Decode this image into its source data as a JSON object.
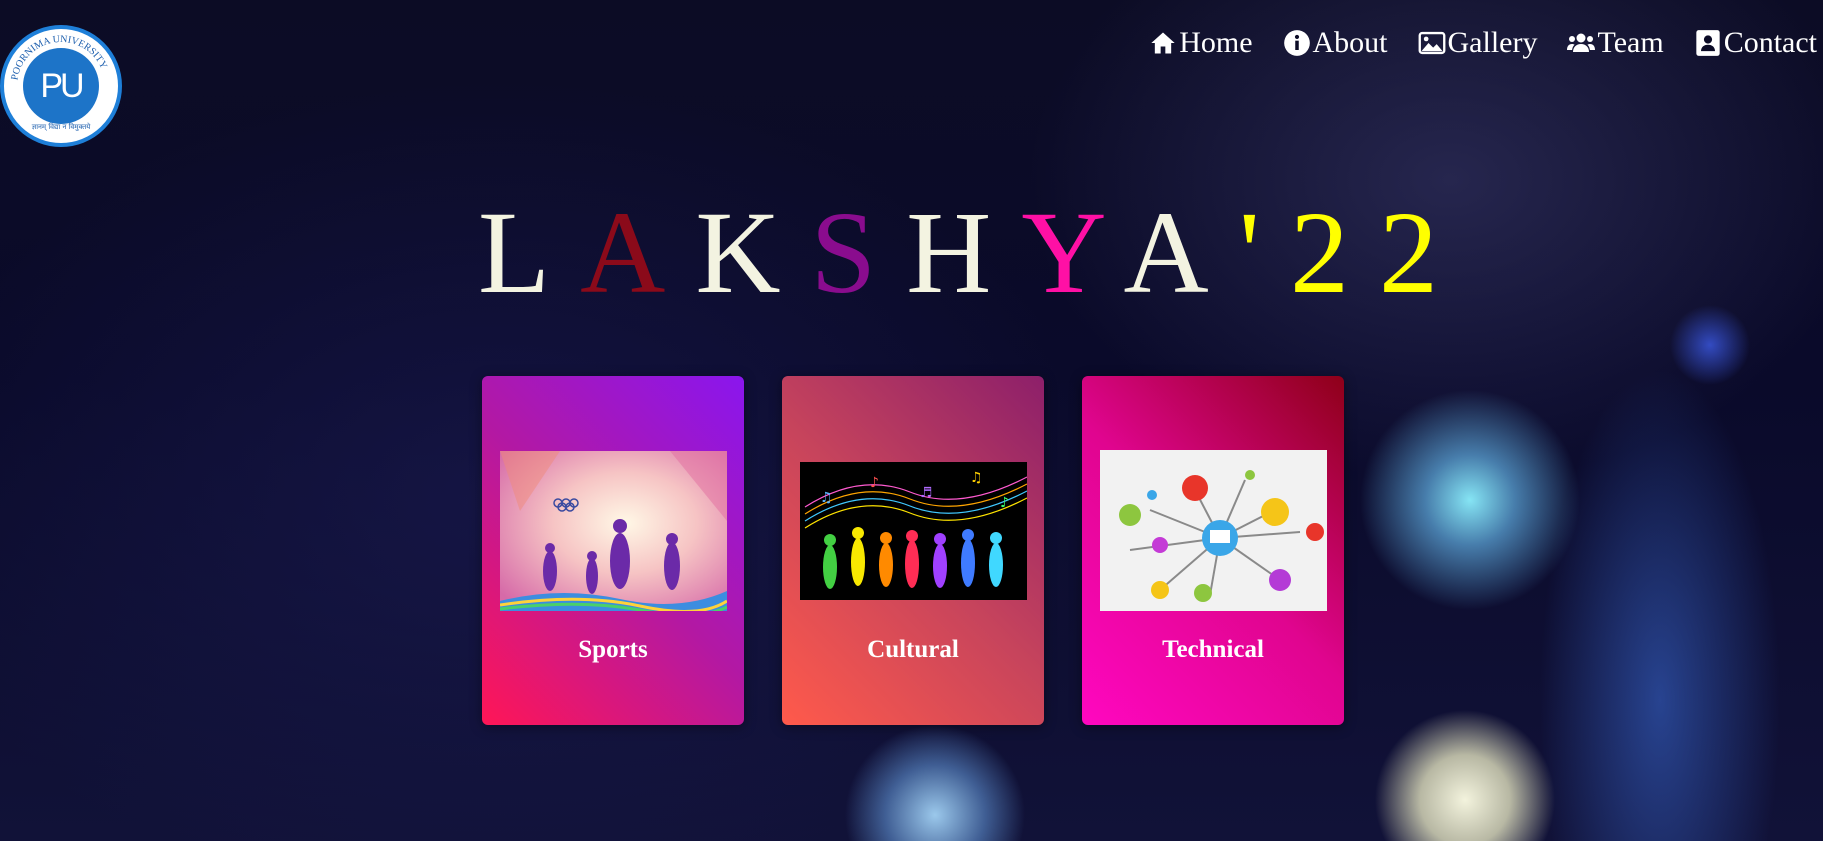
{
  "logo": {
    "ring_text": "POORNIMA UNIVERSITY",
    "monogram": "PU",
    "motto": "ज्ञानम् विद्या न विमुक्तये"
  },
  "nav": {
    "items": [
      {
        "label": "Home",
        "icon": "home-icon"
      },
      {
        "label": "About",
        "icon": "info-icon"
      },
      {
        "label": "Gallery",
        "icon": "image-icon"
      },
      {
        "label": "Team",
        "icon": "users-icon"
      },
      {
        "label": "Contact",
        "icon": "contact-icon"
      }
    ]
  },
  "title": {
    "letters": [
      {
        "char": "L",
        "color": "#f3f3e1"
      },
      {
        "char": "A",
        "color": "#8b0a1a"
      },
      {
        "char": "K",
        "color": "#f3f3e1"
      },
      {
        "char": "S",
        "color": "#8a0c8e"
      },
      {
        "char": "H",
        "color": "#f3f3e1"
      },
      {
        "char": "Y",
        "color": "#ff10a5"
      },
      {
        "char": "A",
        "color": "#f3f3e1"
      },
      {
        "char": "'",
        "color": "#ffff00"
      },
      {
        "char": "2",
        "color": "#ffff00"
      },
      {
        "char": "2",
        "color": "#ffff00"
      }
    ]
  },
  "cards": [
    {
      "label": "Sports",
      "image": "sports-illustration"
    },
    {
      "label": "Cultural",
      "image": "cultural-dancers-illustration"
    },
    {
      "label": "Technical",
      "image": "technology-network-illustration"
    }
  ]
}
